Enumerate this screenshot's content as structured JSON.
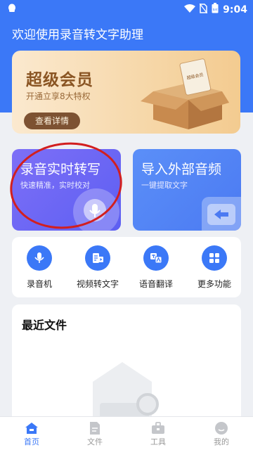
{
  "status_bar": {
    "time": "9:04",
    "battery_label": "bat"
  },
  "app_title": "欢迎使用录音转文字助理",
  "vip": {
    "title": "超级会员",
    "subtitle": "开通立享8大特权",
    "button": "查看详情",
    "box_label": "超级会员"
  },
  "cards": {
    "record": {
      "title": "录音实时转写",
      "subtitle": "快速精准，实时校对"
    },
    "import": {
      "title": "导入外部音频",
      "subtitle": "一键提取文字"
    }
  },
  "tools": [
    {
      "label": "录音机",
      "icon": "mic-icon"
    },
    {
      "label": "视频转文字",
      "icon": "video-to-text-icon"
    },
    {
      "label": "语音翻译",
      "icon": "voice-translate-icon"
    },
    {
      "label": "更多功能",
      "icon": "grid-icon"
    }
  ],
  "recent": {
    "title": "最近文件"
  },
  "nav": [
    {
      "label": "首页",
      "icon": "home-icon",
      "active": true
    },
    {
      "label": "文件",
      "icon": "file-icon",
      "active": false
    },
    {
      "label": "工具",
      "icon": "toolbox-icon",
      "active": false
    },
    {
      "label": "我的",
      "icon": "profile-icon",
      "active": false
    }
  ],
  "colors": {
    "primary": "#3b78f7",
    "record_card": "#6a66f5",
    "import_card": "#5286f6",
    "vip_brown": "#7d5232",
    "annotation_red": "#d21f1f"
  }
}
